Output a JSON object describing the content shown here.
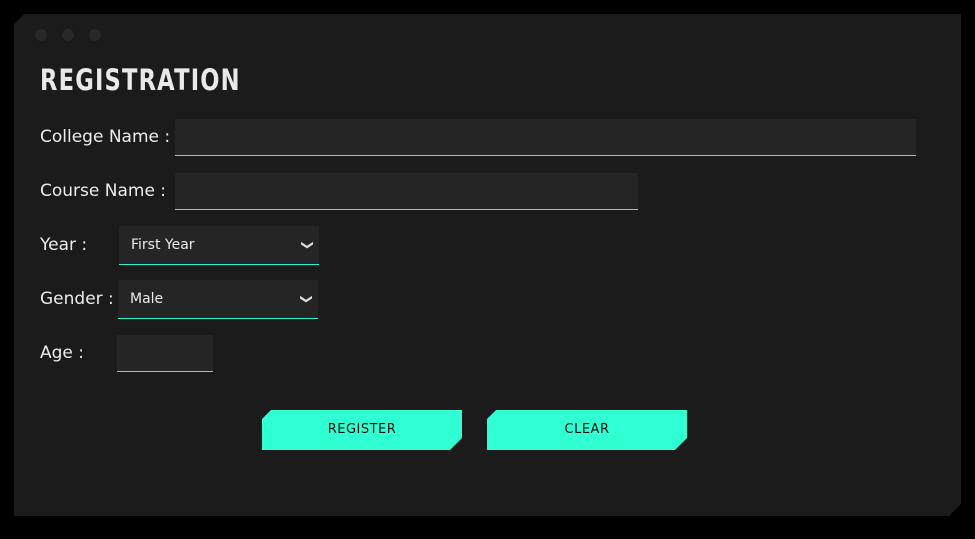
{
  "form": {
    "title": "REGISTRATION",
    "college_label": "College Name :",
    "college_value": "",
    "course_label": "Course Name :",
    "course_value": "",
    "year_label": "Year :",
    "year_selected": "First Year",
    "gender_label": "Gender :",
    "gender_selected": "Male",
    "age_label": "Age :",
    "age_value": ""
  },
  "buttons": {
    "register": "REGISTER",
    "clear": "CLEAR"
  },
  "colors": {
    "accent": "#2fffd2",
    "panel": "#1b1b1b",
    "field": "#252525",
    "underline": "#2ef5cf"
  },
  "icons": {
    "select_arrow": "chevron-down-icon"
  }
}
